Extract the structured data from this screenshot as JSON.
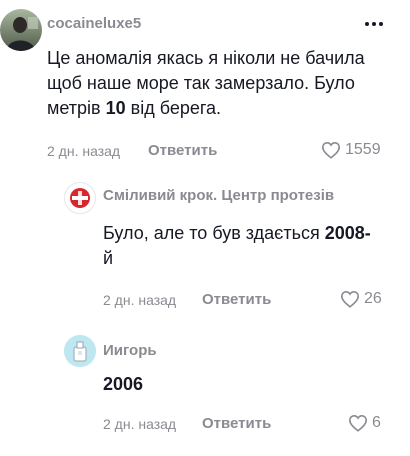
{
  "comments": [
    {
      "username": "cocaineluxe5",
      "text_before": "Це аномалія якась я ніколи не бачила щоб наше море так замерзало. Було метрів ",
      "text_bold": "10",
      "text_after": " від берега.",
      "time": "2 дн. назад",
      "reply_label": "Ответить",
      "likes": "1559"
    }
  ],
  "replies": [
    {
      "username": "Сміливий крок. Центр протезів",
      "text_before": "Було, але то був здається ",
      "text_bold": "2008-",
      "text_line2": "й",
      "time": "2 дн. назад",
      "reply_label": "Ответить",
      "likes": "26"
    },
    {
      "username": "Иигорь",
      "text": "2006",
      "time": "2 дн. назад",
      "reply_label": "Ответить",
      "likes": "6"
    }
  ],
  "icons": {
    "more": "more-dots-icon",
    "like": "heart-outline-icon"
  },
  "colors": {
    "secondary_text": "#8a8b91",
    "primary_text": "#161823"
  }
}
